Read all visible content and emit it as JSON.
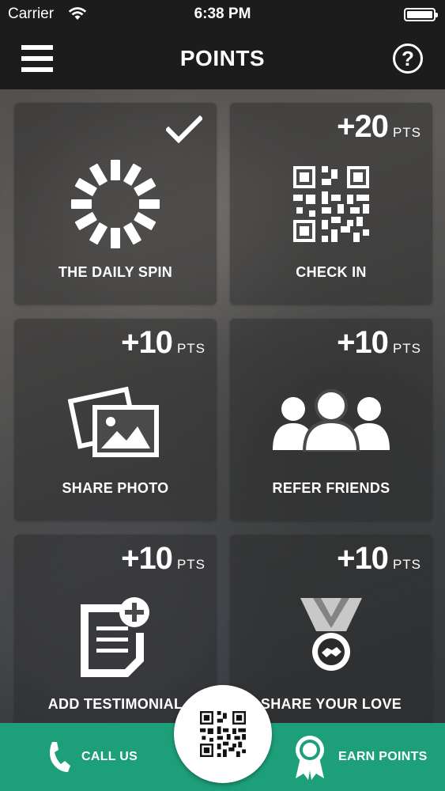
{
  "status_bar": {
    "carrier": "Carrier",
    "time": "6:38 PM"
  },
  "nav": {
    "title": "POINTS",
    "help_glyph": "?",
    "menu_icon": "hamburger-menu-icon",
    "help_icon": "help-circle-icon"
  },
  "tiles": [
    {
      "label": "THE DAILY SPIN",
      "points": "",
      "pts_unit": "",
      "completed": true,
      "icon": "spinner-icon"
    },
    {
      "label": "CHECK IN",
      "points": "+20",
      "pts_unit": "PTS",
      "completed": false,
      "icon": "qr-code-icon"
    },
    {
      "label": "SHARE PHOTO",
      "points": "+10",
      "pts_unit": "PTS",
      "completed": false,
      "icon": "photos-icon"
    },
    {
      "label": "REFER FRIENDS",
      "points": "+10",
      "pts_unit": "PTS",
      "completed": false,
      "icon": "people-icon"
    },
    {
      "label": "ADD TESTIMONIAL",
      "points": "+10",
      "pts_unit": "PTS",
      "completed": false,
      "icon": "add-document-icon"
    },
    {
      "label": "SHARE YOUR LOVE",
      "points": "+10",
      "pts_unit": "PTS",
      "completed": false,
      "icon": "medal-icon"
    }
  ],
  "bottom_bar": {
    "call_label": "CALL US",
    "earn_label": "EARN POINTS",
    "center_icon": "qr-code-icon",
    "accent": "#1d9f7a"
  }
}
